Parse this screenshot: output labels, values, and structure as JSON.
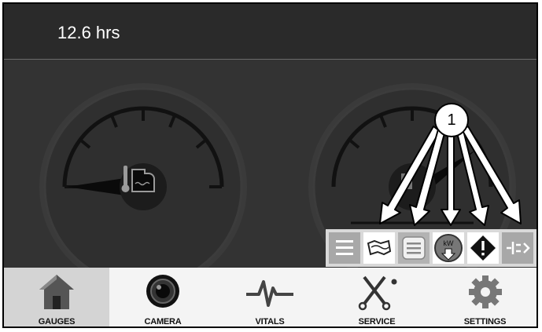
{
  "header": {
    "hours": "12.6 hrs"
  },
  "callout": {
    "number": "1"
  },
  "toolbar": {
    "buttons": [
      {
        "icon": "menu-icon"
      },
      {
        "icon": "map-icon"
      },
      {
        "icon": "notes-icon"
      },
      {
        "icon": "kw-power-icon",
        "text": "kW"
      },
      {
        "icon": "warning-icon"
      },
      {
        "icon": "expand-icon"
      }
    ]
  },
  "nav": {
    "items": [
      {
        "label": "GAUGES",
        "icon": "home-icon",
        "active": true
      },
      {
        "label": "CAMERA",
        "icon": "camera-icon"
      },
      {
        "label": "VITALS",
        "icon": "pulse-icon"
      },
      {
        "label": "SERVICE",
        "icon": "tools-icon"
      },
      {
        "label": "SETTINGS",
        "icon": "gear-icon"
      }
    ]
  },
  "colors": {
    "background": "#2e2e2e",
    "header": "#2a2a2a",
    "toolbar_gray": "#a8a8a8",
    "nav_bg": "#f4f4f4",
    "nav_active": "#d4d4d4"
  }
}
